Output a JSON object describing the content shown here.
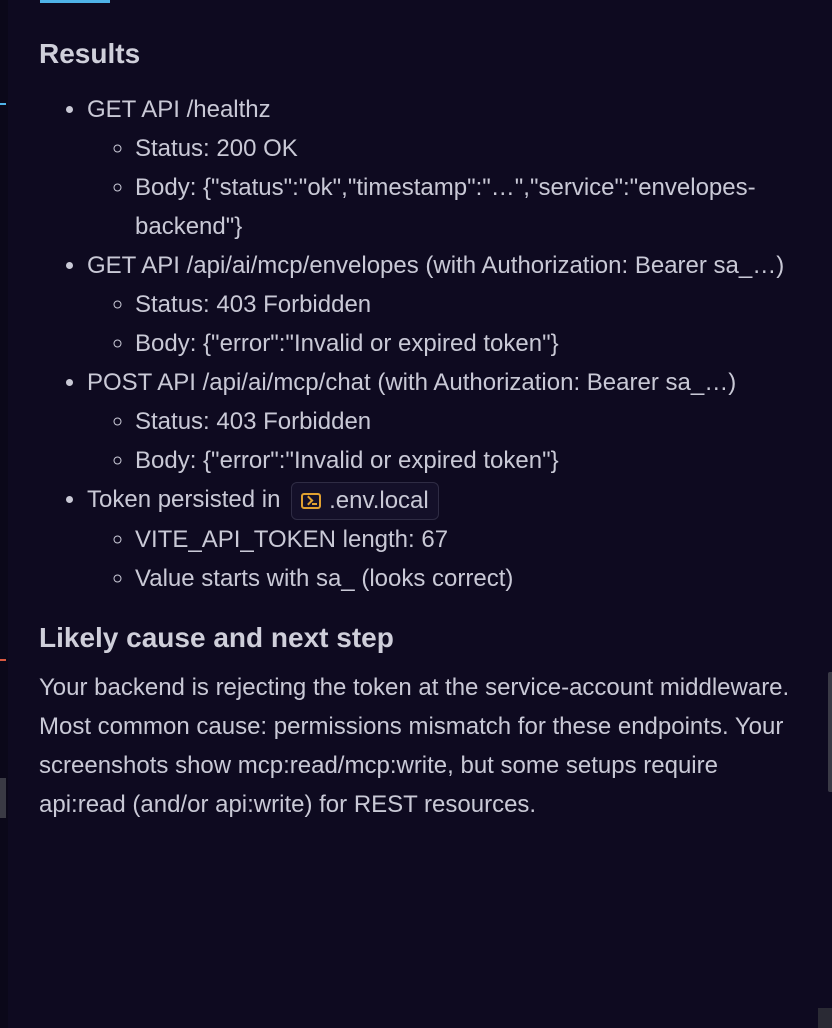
{
  "headings": {
    "results": "Results",
    "next_step": "Likely cause and next step"
  },
  "results": {
    "item1": {
      "label": "GET API /healthz",
      "status": "Status: 200 OK",
      "body": "Body: {\"status\":\"ok\",\"timestamp\":\"…\",\"service\":\"envelopes-backend\"}"
    },
    "item2": {
      "label": "GET API /api/ai/mcp/envelopes (with Authorization: Bearer sa_…)",
      "status": "Status: 403 Forbidden",
      "body": "Body: {\"error\":\"Invalid or expired token\"}"
    },
    "item3": {
      "label": "POST API /api/ai/mcp/chat (with Authorization: Bearer sa_…)",
      "status": "Status: 403 Forbidden",
      "body": "Body: {\"error\":\"Invalid or expired token\"}"
    },
    "item4": {
      "label": "Token persisted in",
      "file": ".env.local",
      "file_icon": "terminal-icon",
      "length": "VITE_API_TOKEN length: 67",
      "prefix": "Value starts with sa_ (looks correct)"
    }
  },
  "explanation": "Your backend is rejecting the token at the service-account middleware. Most common cause: permissions mismatch for these endpoints. Your screenshots show mcp:read/mcp:write, but some setups require api:read (and/or api:write) for REST resources.",
  "colors": {
    "background": "#0e0a20",
    "text": "#c9c9d6",
    "accent": "#4fb3e8",
    "icon": "#e0a030"
  }
}
